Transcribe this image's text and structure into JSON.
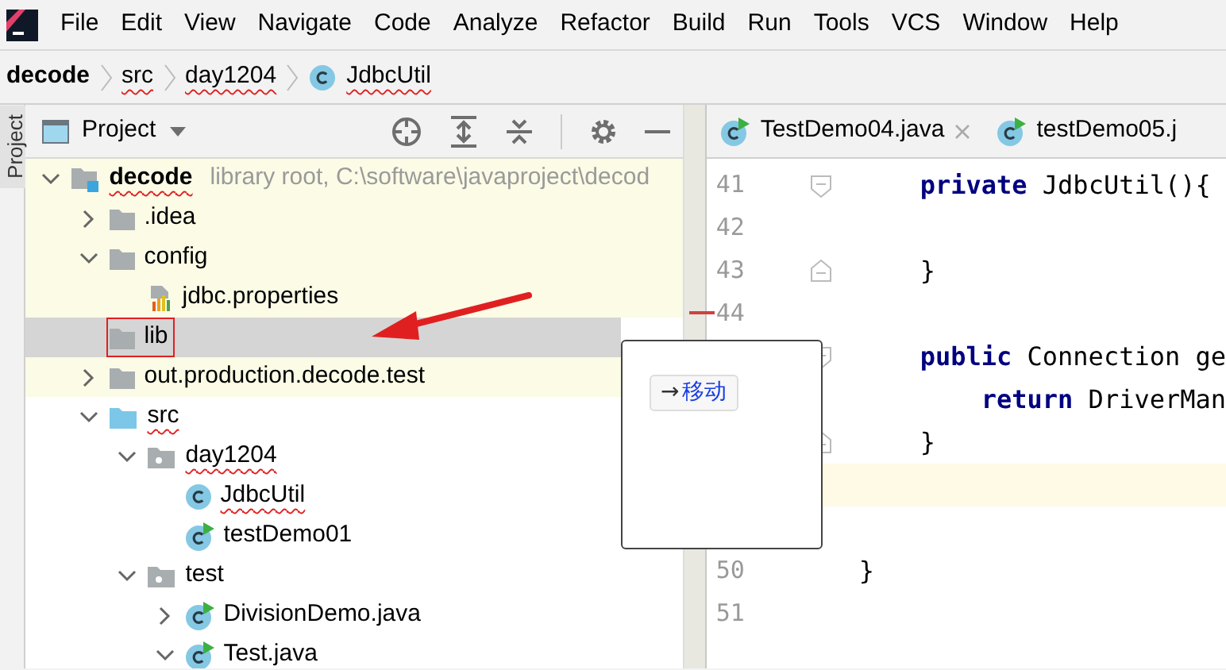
{
  "menu_bar": {
    "items": [
      "File",
      "Edit",
      "View",
      "Navigate",
      "Code",
      "Analyze",
      "Refactor",
      "Build",
      "Run",
      "Tools",
      "VCS",
      "Window",
      "Help"
    ]
  },
  "breadcrumb": [
    {
      "label": "decode",
      "kind": "module",
      "error": false
    },
    {
      "label": "src",
      "kind": "folder",
      "error": true
    },
    {
      "label": "day1204",
      "kind": "folder",
      "error": true
    },
    {
      "label": "JdbcUtil",
      "kind": "class",
      "error": true
    }
  ],
  "side_stripe": {
    "label": "Project"
  },
  "project_panel": {
    "title": "Project",
    "tree": [
      {
        "label": "decode",
        "note": "library root,  C:\\software\\javaproject\\decod",
        "kind": "module",
        "expanded": true,
        "error": true,
        "selected": false,
        "tinted": true,
        "children": [
          {
            "label": ".idea",
            "kind": "folder",
            "expanded": false,
            "error": false,
            "selected": false,
            "tinted": true
          },
          {
            "label": "config",
            "kind": "folder",
            "expanded": true,
            "error": false,
            "selected": false,
            "tinted": true,
            "children": [
              {
                "label": "jdbc.properties",
                "kind": "properties",
                "error": false,
                "selected": false,
                "tinted": true
              }
            ]
          },
          {
            "label": "lib",
            "kind": "folder",
            "error": false,
            "selected": true,
            "boxed": true
          },
          {
            "label": "out.production.decode.test",
            "kind": "folder",
            "expanded": false,
            "error": false,
            "selected": false,
            "tinted": true
          },
          {
            "label": "src",
            "kind": "source",
            "expanded": true,
            "error": true,
            "selected": false,
            "tinted": false,
            "children": [
              {
                "label": "day1204",
                "kind": "package",
                "expanded": true,
                "error": true,
                "selected": false,
                "tinted": false,
                "children": [
                  {
                    "label": "JdbcUtil",
                    "kind": "class",
                    "error": true,
                    "selected": false,
                    "tinted": false
                  },
                  {
                    "label": "testDemo01",
                    "kind": "runnable",
                    "error": false,
                    "selected": false,
                    "tinted": false
                  }
                ]
              },
              {
                "label": "test",
                "kind": "package",
                "expanded": true,
                "error": false,
                "selected": false,
                "tinted": false,
                "children": [
                  {
                    "label": "DivisionDemo.java",
                    "kind": "runnable",
                    "expanded": false,
                    "error": false,
                    "selected": false,
                    "tinted": false
                  },
                  {
                    "label": "Test.java",
                    "kind": "runnable",
                    "expanded": true,
                    "error": false,
                    "selected": false,
                    "tinted": false
                  }
                ]
              }
            ]
          }
        ]
      }
    ]
  },
  "editor": {
    "tabs": [
      {
        "label": "TestDemo04.java",
        "selected": false,
        "closable": true
      },
      {
        "label": "testDemo05.j",
        "selected": false,
        "closable": false
      }
    ],
    "lines": [
      {
        "number": "41",
        "code": "    **private** JdbcUtil(){",
        "kind": "fold_start",
        "current": false
      },
      {
        "number": "42",
        "kind": "plain",
        "current": false
      },
      {
        "number": "43",
        "code": "    }",
        "kind": "fold_end",
        "current": false
      },
      {
        "number": "44",
        "kind": "plain",
        "current": false
      },
      {
        "code": "    **public** Connection ge",
        "kind": "fold_start",
        "current": false
      },
      {
        "code": "        **return** DriverMan",
        "kind": "plain",
        "current": false
      },
      {
        "code": "    }",
        "kind": "fold_end",
        "current": false
      },
      {
        "kind": "plain",
        "current": true
      },
      {
        "kind": "plain",
        "current": false
      },
      {
        "number": "50",
        "code": "}",
        "kind": "plain",
        "current": false
      },
      {
        "number": "51",
        "kind": "plain",
        "current": false
      }
    ]
  },
  "popup": {
    "icon": "→",
    "button": "移动"
  }
}
